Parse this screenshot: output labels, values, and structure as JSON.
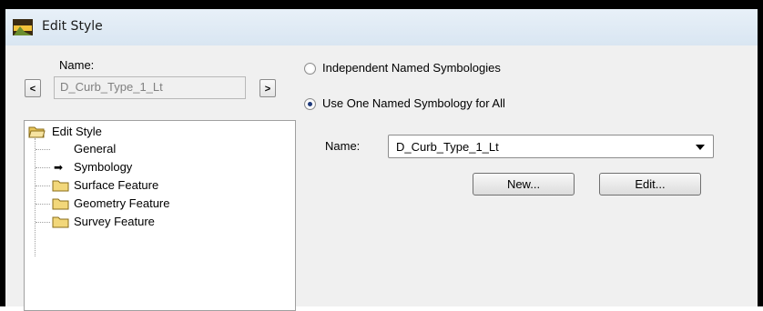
{
  "window": {
    "title": "Edit Style"
  },
  "left": {
    "name_label": "Name:",
    "prev_label": "<",
    "next_label": ">",
    "current_name": "D_Curb_Type_1_Lt",
    "tree": {
      "root": "Edit Style",
      "items": [
        "General",
        "Symbology",
        "Surface Feature",
        "Geometry Feature",
        "Survey Feature"
      ]
    }
  },
  "right": {
    "option_independent": "Independent Named Symbologies",
    "option_one": "Use One Named Symbology for All",
    "selected_option": "Use One Named Symbology for All",
    "name_label": "Name:",
    "symbology_value": "D_Curb_Type_1_Lt",
    "new_label": "New...",
    "edit_label": "Edit..."
  },
  "colors": {
    "titlebar": "#dde8f3",
    "folder": "#f2d77a",
    "radio_dot": "#1f3a7a"
  }
}
